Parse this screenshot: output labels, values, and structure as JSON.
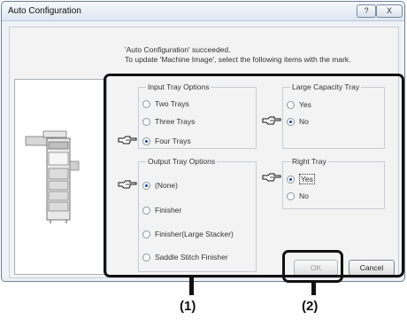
{
  "window": {
    "title": "Auto Configuration",
    "help_glyph": "?",
    "close_glyph": "X"
  },
  "message": {
    "line1": "'Auto Configuration' succeeded.",
    "line2": "To update 'Machine Image', select the following items with the mark."
  },
  "input_tray": {
    "label": "Input Tray Options",
    "options": [
      {
        "label": "Two Trays",
        "selected": false
      },
      {
        "label": "Three Trays",
        "selected": false
      },
      {
        "label": "Four Trays",
        "selected": true
      }
    ]
  },
  "large_capacity_tray": {
    "label": "Large Capacity Tray",
    "options": [
      {
        "label": "Yes",
        "selected": false
      },
      {
        "label": "No",
        "selected": true
      }
    ]
  },
  "output_tray": {
    "label": "Output Tray Options",
    "options": [
      {
        "label": "(None)",
        "selected": true
      },
      {
        "label": "Finisher",
        "selected": false
      },
      {
        "label": "Finisher(Large Stacker)",
        "selected": false
      },
      {
        "label": "Saddle Stitch Finisher",
        "selected": false
      }
    ]
  },
  "right_tray": {
    "label": "Right Tray",
    "options": [
      {
        "label": "Yes",
        "selected": true
      },
      {
        "label": "No",
        "selected": false
      }
    ]
  },
  "buttons": {
    "ok": "OK",
    "cancel": "Cancel"
  },
  "callouts": {
    "one": "(1)",
    "two": "(2)"
  },
  "colors": {
    "highlight": "#111111",
    "selected_dot": "#1a3fa3"
  }
}
